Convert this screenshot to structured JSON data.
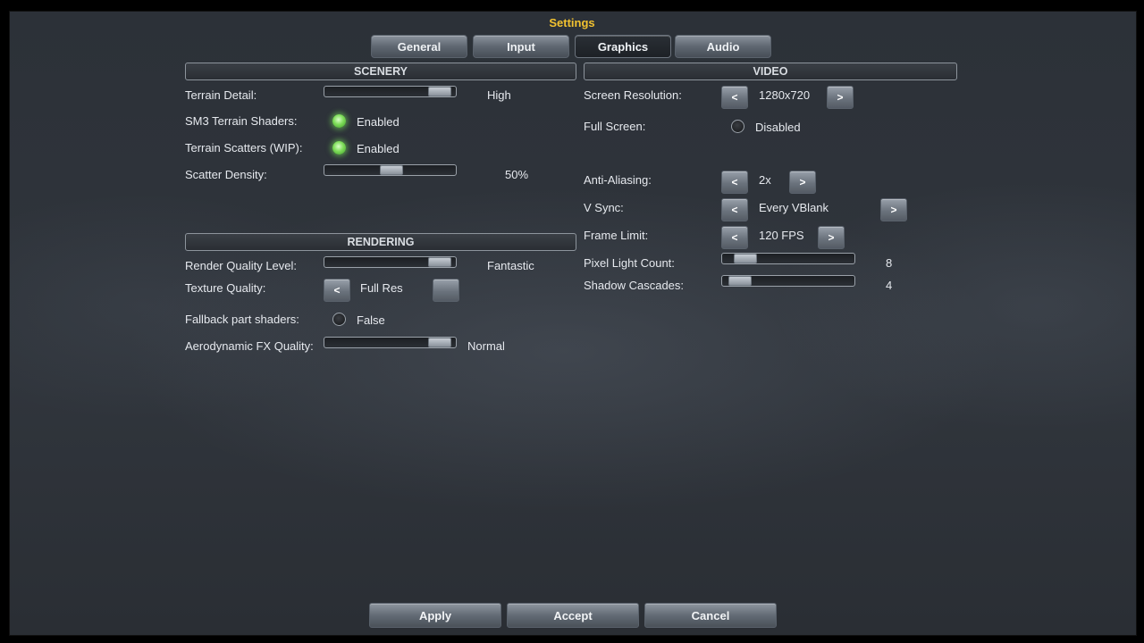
{
  "window": {
    "title": "Settings"
  },
  "tabs": [
    {
      "label": "General",
      "active": false
    },
    {
      "label": "Input",
      "active": false
    },
    {
      "label": "Graphics",
      "active": true
    },
    {
      "label": "Audio",
      "active": false
    }
  ],
  "scenery": {
    "header": "SCENERY",
    "terrain_detail": {
      "label": "Terrain Detail:",
      "value": "High",
      "level": 0.95
    },
    "sm3_terrain_shaders": {
      "label": "SM3 Terrain Shaders:",
      "value": "Enabled",
      "on": true
    },
    "terrain_scatters": {
      "label": "Terrain Scatters (WIP):",
      "value": "Enabled",
      "on": true
    },
    "scatter_density": {
      "label": "Scatter Density:",
      "value": "50%",
      "level": 0.5
    }
  },
  "rendering": {
    "header": "RENDERING",
    "render_quality": {
      "label": "Render Quality Level:",
      "value": "Fantastic",
      "level": 0.95
    },
    "texture_quality": {
      "label": "Texture Quality:",
      "value": "Full Res",
      "prev_label": "<"
    },
    "fallback_shaders": {
      "label": "Fallback part shaders:",
      "value": "False",
      "on": false
    },
    "aero_fx": {
      "label": "Aerodynamic FX Quality:",
      "value": "Normal",
      "level": 0.95
    }
  },
  "video": {
    "header": "VIDEO",
    "screen_resolution": {
      "label": "Screen Resolution:",
      "value": "1280x720",
      "prev_label": "<",
      "next_label": ">"
    },
    "full_screen": {
      "label": "Full Screen:",
      "value": "Disabled",
      "on": false
    },
    "anti_aliasing": {
      "label": "Anti-Aliasing:",
      "value": "2x",
      "prev_label": "<",
      "next_label": ">"
    },
    "v_sync": {
      "label": "V Sync:",
      "value": "Every VBlank",
      "prev_label": "<",
      "next_label": ">"
    },
    "frame_limit": {
      "label": "Frame Limit:",
      "value": "120 FPS",
      "prev_label": "<",
      "next_label": ">"
    },
    "pixel_light_count": {
      "label": "Pixel Light Count:",
      "value": "8",
      "level": 0.1
    },
    "shadow_cascades": {
      "label": "Shadow Cascades:",
      "value": "4",
      "level": 0.05
    }
  },
  "buttons": {
    "apply": "Apply",
    "accept": "Accept",
    "cancel": "Cancel"
  },
  "colors": {
    "title": "#f2c230",
    "toggle_on": "#7ddc58"
  }
}
